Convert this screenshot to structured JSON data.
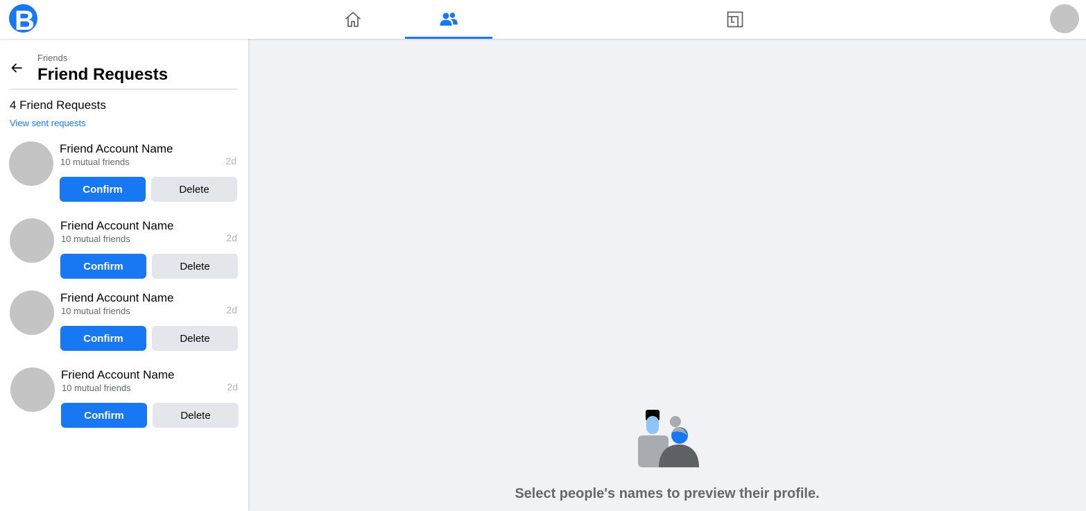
{
  "app": {
    "logo_letter": "B",
    "brand_color": "#1877f2"
  },
  "topnav": {
    "tabs": [
      {
        "name": "home",
        "icon": "home-icon",
        "active": false
      },
      {
        "name": "friends",
        "icon": "friends-icon",
        "active": true
      },
      {
        "name": "pages",
        "icon": "pages-icon",
        "active": false
      }
    ],
    "avatar": "profile-avatar"
  },
  "sidebar": {
    "breadcrumb": "Friends",
    "title": "Friend Requests",
    "count_label": "4 Friend Requests",
    "sent_link": "View sent requests",
    "requests": [
      {
        "name": "Friend Account Name",
        "mutual": "10 mutual friends",
        "age": "2d",
        "confirm": "Confirm",
        "delete": "Delete"
      },
      {
        "name": "Friend Account Name",
        "mutual": "10 mutual friends",
        "age": "2d",
        "confirm": "Confirm",
        "delete": "Delete"
      },
      {
        "name": "Friend Account Name",
        "mutual": "10 mutual friends",
        "age": "2d",
        "confirm": "Confirm",
        "delete": "Delete"
      },
      {
        "name": "Friend Account Name",
        "mutual": "10 mutual friends",
        "age": "2d",
        "confirm": "Confirm",
        "delete": "Delete"
      }
    ]
  },
  "main": {
    "empty_message": "Select people's names to preview their profile."
  }
}
